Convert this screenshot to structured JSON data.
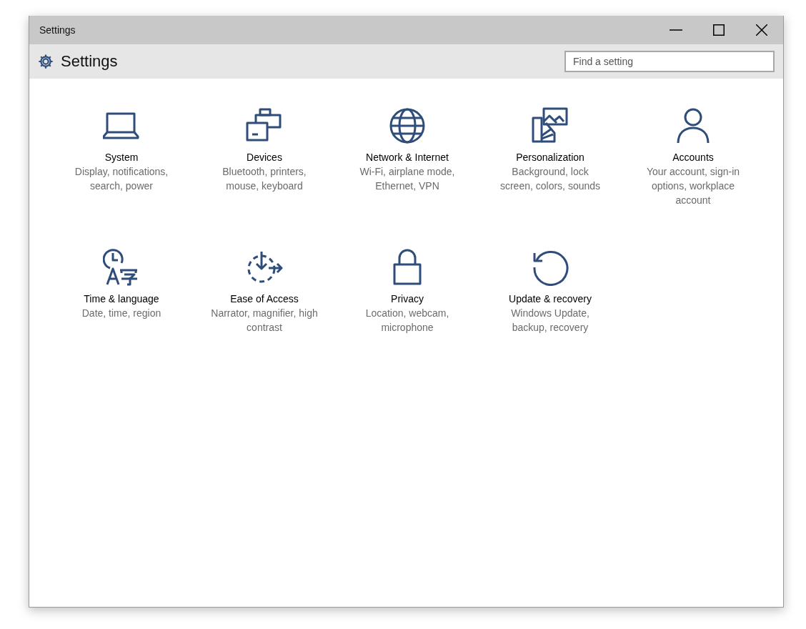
{
  "window": {
    "title": "Settings"
  },
  "header": {
    "title": "Settings"
  },
  "search": {
    "placeholder": "Find a setting"
  },
  "categories": [
    {
      "title": "System",
      "description": "Display, notifications, search, power"
    },
    {
      "title": "Devices",
      "description": "Bluetooth, printers, mouse, keyboard"
    },
    {
      "title": "Network & Internet",
      "description": "Wi-Fi, airplane mode, Ethernet, VPN"
    },
    {
      "title": "Personalization",
      "description": "Background, lock screen, colors, sounds"
    },
    {
      "title": "Accounts",
      "description": "Your account, sign-in options, workplace account"
    },
    {
      "title": "Time & language",
      "description": "Date, time, region"
    },
    {
      "title": "Ease of Access",
      "description": "Narrator, magnifier, high contrast"
    },
    {
      "title": "Privacy",
      "description": "Location, webcam, microphone"
    },
    {
      "title": "Update & recovery",
      "description": "Windows Update, backup, recovery"
    }
  ]
}
